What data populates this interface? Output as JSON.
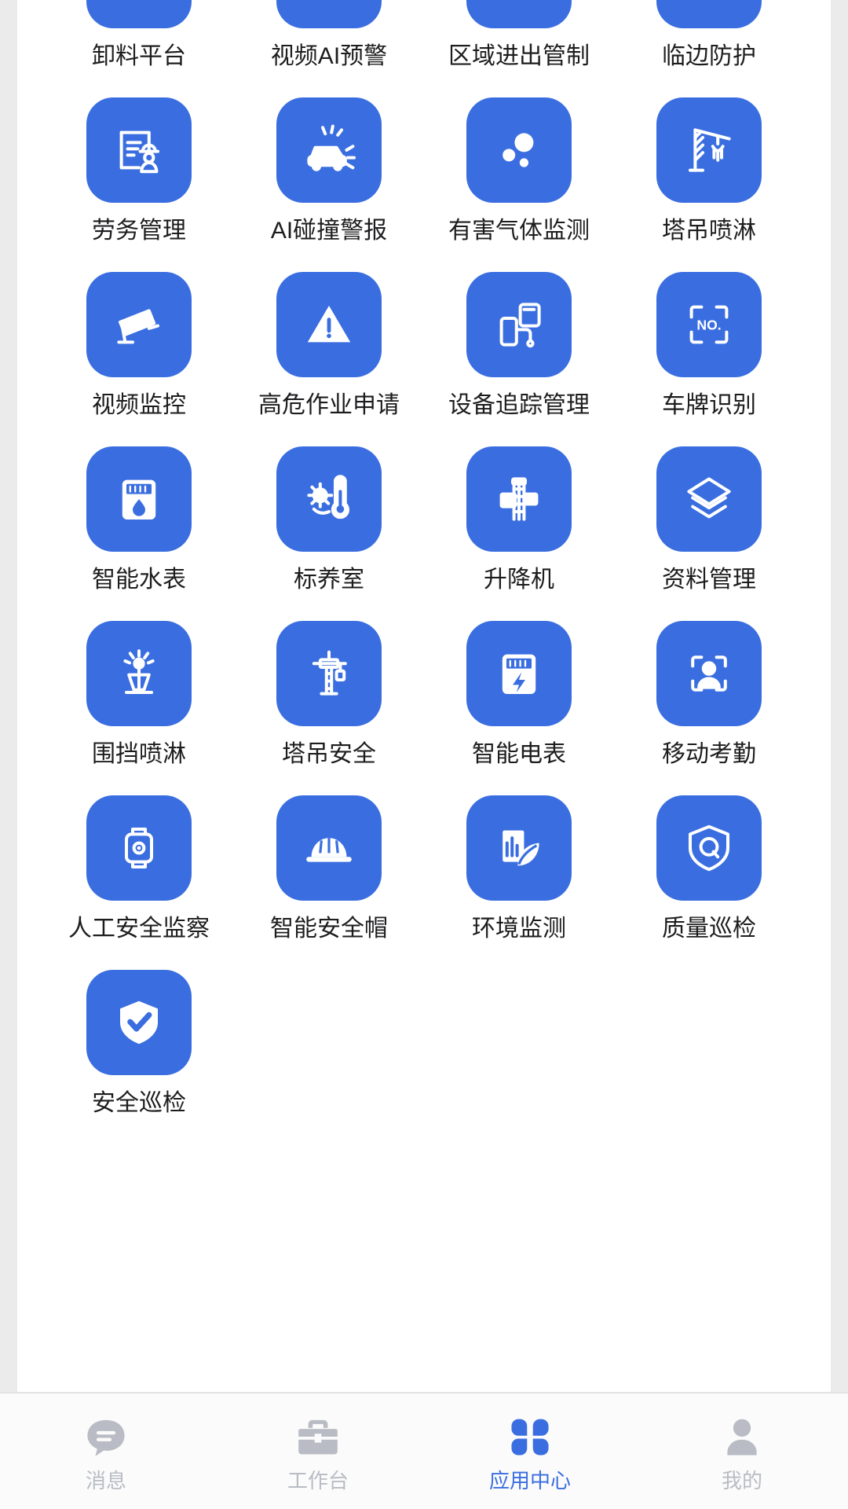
{
  "colors": {
    "accent": "#3a6ee0",
    "tile_bg": "#3a6ee0",
    "page_bg": "#ffffff",
    "screen_bg": "#ebebeb",
    "label_text": "#1d1d1f",
    "tab_inactive": "#b9bcc4",
    "tab_active": "#3a6ee0",
    "tabbar_bg": "#fbfbfb"
  },
  "app_grid": {
    "columns": 4,
    "items": [
      {
        "label": "卸料平台",
        "icon": "unloading-platform-icon"
      },
      {
        "label": "视频AI预警",
        "icon": "video-ai-alert-icon"
      },
      {
        "label": "区域进出管制",
        "icon": "area-access-control-lock-icon"
      },
      {
        "label": "临边防护",
        "icon": "edge-protection-railing-icon"
      },
      {
        "label": "劳务管理",
        "icon": "labor-management-worker-document-icon"
      },
      {
        "label": "AI碰撞警报",
        "icon": "ai-collision-alarm-car-icon"
      },
      {
        "label": "有害气体监测",
        "icon": "hazardous-gas-monitoring-bubbles-icon"
      },
      {
        "label": "塔吊喷淋",
        "icon": "tower-crane-spray-icon"
      },
      {
        "label": "视频监控",
        "icon": "video-surveillance-camera-icon"
      },
      {
        "label": "高危作业申请",
        "icon": "high-risk-work-warning-triangle-icon"
      },
      {
        "label": "设备追踪管理",
        "icon": "equipment-tracking-devices-icon"
      },
      {
        "label": "车牌识别",
        "icon": "license-plate-recognition-no-icon"
      },
      {
        "label": "智能水表",
        "icon": "smart-water-meter-icon"
      },
      {
        "label": "标养室",
        "icon": "curing-room-thermometer-icon"
      },
      {
        "label": "升降机",
        "icon": "hoist-elevator-icon"
      },
      {
        "label": "资料管理",
        "icon": "document-management-layers-icon"
      },
      {
        "label": "围挡喷淋",
        "icon": "fence-spray-nozzle-icon"
      },
      {
        "label": "塔吊安全",
        "icon": "tower-crane-safety-icon"
      },
      {
        "label": "智能电表",
        "icon": "smart-electric-meter-icon"
      },
      {
        "label": "移动考勤",
        "icon": "mobile-attendance-face-scan-icon"
      },
      {
        "label": "人工安全监察",
        "icon": "manual-safety-inspection-watch-icon"
      },
      {
        "label": "智能安全帽",
        "icon": "smart-helmet-icon"
      },
      {
        "label": "环境监测",
        "icon": "environment-monitoring-leaf-icon"
      },
      {
        "label": "质量巡检",
        "icon": "quality-inspection-shield-q-icon"
      },
      {
        "label": "安全巡检",
        "icon": "safety-inspection-shield-check-icon"
      }
    ]
  },
  "tabbar": {
    "active_index": 2,
    "tabs": [
      {
        "label": "消息",
        "icon": "message-bubble-icon"
      },
      {
        "label": "工作台",
        "icon": "briefcase-icon"
      },
      {
        "label": "应用中心",
        "icon": "app-center-clover-icon"
      },
      {
        "label": "我的",
        "icon": "profile-person-icon"
      }
    ]
  }
}
